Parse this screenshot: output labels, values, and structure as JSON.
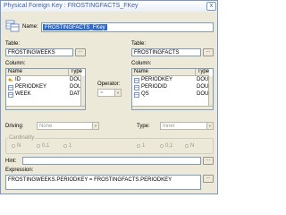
{
  "window": {
    "title": "Physical Foreign Key  :  FROSTINGFACTS_FKey",
    "close_glyph": "x"
  },
  "name": {
    "label": "Name:",
    "value": "FROSTINGFACTS_FKey"
  },
  "left": {
    "table_label": "Table:",
    "table_value": "FROSTINGWEEKS",
    "browse_glyph": "...",
    "column_label": "Column:",
    "headers": [
      "Name",
      "Type"
    ],
    "rows": [
      {
        "name": "ID",
        "type": "DOUI"
      },
      {
        "name": "PERIODKEY",
        "type": "DOUI"
      },
      {
        "name": "WEEK",
        "type": "DATE"
      }
    ]
  },
  "operator": {
    "label": "Operator:",
    "value": "="
  },
  "right": {
    "table_label": "Table:",
    "table_value": "FROSTINGFACTS",
    "browse_glyph": "...",
    "column_label": "Column:",
    "headers": [
      "Name",
      "Type"
    ],
    "rows": [
      {
        "name": "PERIODKEY",
        "type": "DOUI"
      },
      {
        "name": "PERIODID",
        "type": "DOUI"
      },
      {
        "name": "QS",
        "type": "DOUI"
      }
    ]
  },
  "driving": {
    "label": "Driving:",
    "value": "None"
  },
  "type": {
    "label": "Type:",
    "value": "Inner"
  },
  "cardinality": {
    "label": "Cardinality",
    "left_options": [
      "N",
      "0,1",
      "1"
    ],
    "right_options": [
      "1",
      "0,1",
      "N"
    ]
  },
  "hint": {
    "label": "Hint:",
    "value": ""
  },
  "expression": {
    "label": "Expression:",
    "value": "FROSTINGWEEKS.PERIODKEY = FROSTINGFACTS.PERIODKEY"
  },
  "colors": {
    "selection": "#316ac5",
    "key_icon": "#d9a200",
    "column_icon": "#5b7fc4"
  }
}
